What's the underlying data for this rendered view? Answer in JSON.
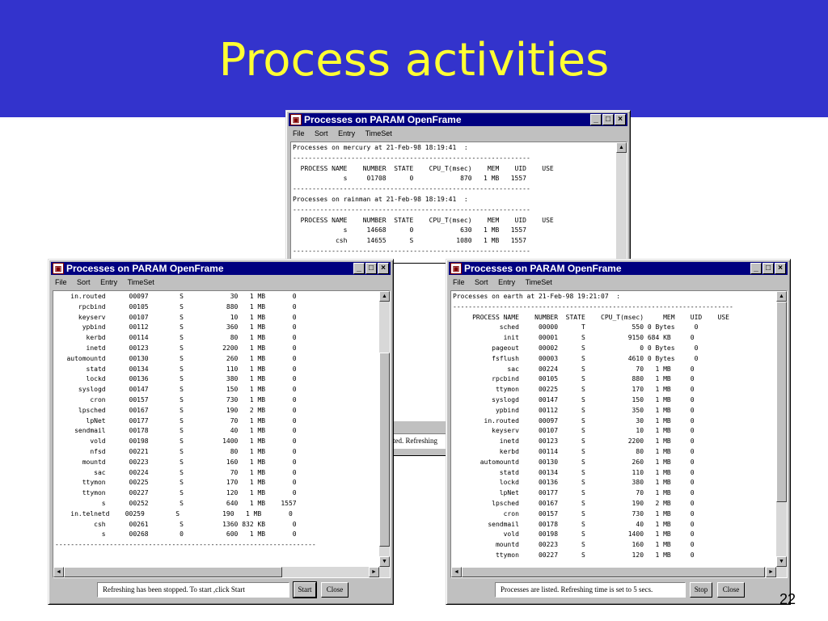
{
  "slide": {
    "title": "Process activities",
    "page_number": "22",
    "header_color": "#3333cc",
    "title_color": "#ffff33"
  },
  "window_title": "Processes on PARAM OpenFrame",
  "window_buttons": {
    "minimize": "_",
    "maximize": "□",
    "close": "×"
  },
  "menu": [
    "File",
    "Sort",
    "Entry",
    "TimeSet"
  ],
  "scroll_glyphs": {
    "up": "▲",
    "down": "▼",
    "left": "◄",
    "right": "►"
  },
  "background_window": {
    "lines": [
      "Processes on mercury at 21-Feb-98 18:19:41  :",
      "-------------------------------------------------------------",
      "  PROCESS NAME    NUMBER  STATE    CPU_T(msec)    MEM    UID    USE",
      "             s     01708      0            870   1 MB   1557      ",
      "-------------------------------------------------------------",
      "Processes on rainman at 21-Feb-98 18:19:41  :",
      "-------------------------------------------------------------",
      "  PROCESS NAME    NUMBER  STATE    CPU_T(msec)    MEM    UID    USE",
      "             s     14668      0            630   1 MB   1557      ",
      "           csh     14655      S           1080   1 MB   1557      ",
      "-------------------------------------------------------------"
    ],
    "partial_status": "ted. Refreshing"
  },
  "left_window": {
    "lines": [
      "    in.routed      00097        S            30   1 MB       0",
      "      rpcbind      00105        S           880   1 MB       0",
      "      keyserv      00107        S            10   1 MB       0",
      "       ypbind      00112        S           360   1 MB       0",
      "        kerbd      00114        S            80   1 MB       0",
      "        inetd      00123        S          2200   1 MB       0",
      "   automountd      00130        S           260   1 MB       0",
      "        statd      00134        S           110   1 MB       0",
      "        lockd      00136        S           380   1 MB       0",
      "      syslogd      00147        S           150   1 MB       0",
      "         cron      00157        S           730   1 MB       0",
      "      lpsched      00167        S           190   2 MB       0",
      "        lpNet      00177        S            70   1 MB       0",
      "     sendmail      00178        S            40   1 MB       0",
      "         vold      00198        S          1400   1 MB       0",
      "         nfsd      00221        S            80   1 MB       0",
      "       mountd      00223        S           160   1 MB       0",
      "          sac      00224        S            70   1 MB       0",
      "       ttymon      00225        S           170   1 MB       0",
      "       ttymon      00227        S           120   1 MB       0",
      "            s      00252        S           640   1 MB    1557",
      "    in.telnetd    00259        S           190   1 MB       0",
      "          csh      00261        S          1360 832 KB       0",
      "            s      00268        0           600   1 MB       0",
      "-------------------------------------------------------------------"
    ],
    "status_text": "Refreshing has been stopped. To start ,click Start",
    "start_label": "Start",
    "close_label": "Close"
  },
  "right_window": {
    "lines": [
      "Processes on earth at 21-Feb-98 19:21:07  :",
      "------------------------------------------------------------------------",
      "     PROCESS NAME    NUMBER  STATE    CPU_T(msec)     MEM    UID    USE",
      "            sched     00000      T            550 0 Bytes     0",
      "             init     00001      S           9150 684 KB     0",
      "          pageout     00002      S              0 0 Bytes     0",
      "          fsflush     00003      S           4610 0 Bytes     0",
      "              sac     00224      S             70   1 MB     0",
      "          rpcbind     00105      S            880   1 MB     0",
      "           ttymon     00225      S            170   1 MB     0",
      "          syslogd     00147      S            150   1 MB     0",
      "           ypbind     00112      S            350   1 MB     0",
      "        in.routed     00097      S             30   1 MB     0",
      "          keyserv     00107      S             10   1 MB     0",
      "            inetd     00123      S           2200   1 MB     0",
      "            kerbd     00114      S             80   1 MB     0",
      "       automountd     00130      S            260   1 MB     0",
      "            statd     00134      S            110   1 MB     0",
      "            lockd     00136      S            380   1 MB     0",
      "            lpNet     00177      S             70   1 MB     0",
      "          lpsched     00167      S            190   2 MB     0",
      "             cron     00157      S            730   1 MB     0",
      "         sendmail     00178      S             40   1 MB     0",
      "             vold     00198      S           1400   1 MB     0",
      "           mountd     00223      S            160   1 MB     0",
      "           ttymon     00227      S            120   1 MB     0"
    ],
    "status_text": "Processes are listed. Refreshing time is set to 5 secs.",
    "stop_label": "Stop",
    "close_label": "Close"
  }
}
